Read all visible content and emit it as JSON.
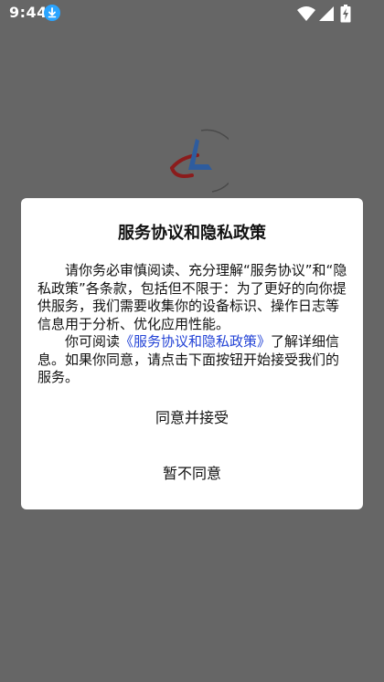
{
  "status_bar": {
    "time": "9:44",
    "icons": [
      "download-icon",
      "wifi-icon",
      "signal-icon",
      "battery-charging-icon"
    ]
  },
  "splash": {
    "logo_icon": "app-logo-icon"
  },
  "dialog": {
    "title": "服务协议和隐私政策",
    "paragraph1": "请你务必审慎阅读、充分理解“服务协议”和“隐私政策”各条款，包括但不限于：为了更好的向你提供服务，我们需要收集你的设备标识、操作日志等信息用于分析、优化应用性能。",
    "paragraph2_prefix": "你可阅读",
    "paragraph2_link": "《服务协议和隐私政策》",
    "paragraph2_suffix": "了解详细信息。如果你同意，请点击下面按钮开始接受我们的服务。",
    "agree_label": "同意并接受",
    "disagree_label": "暂不同意"
  },
  "colors": {
    "overlay": "#666666",
    "link": "#2343d6",
    "download_badge": "#2aa4ff"
  }
}
